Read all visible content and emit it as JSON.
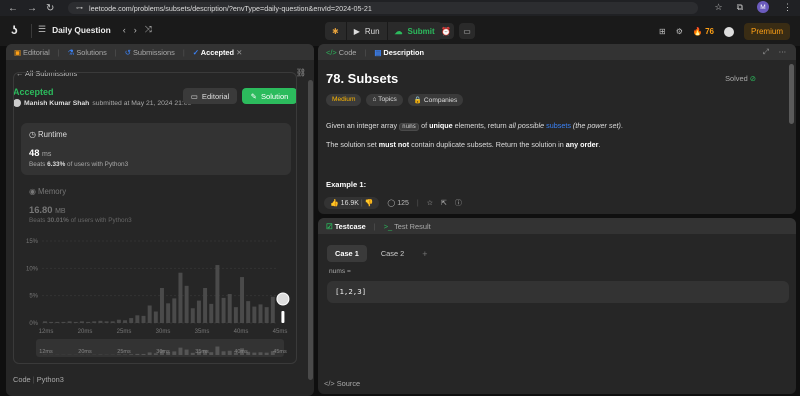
{
  "browser": {
    "url": "leetcode.com/problems/subsets/description/?envType=daily-question&envId=2024-05-21",
    "profile_initial": "M"
  },
  "topbar": {
    "title": "Daily Question",
    "run_label": "Run",
    "submit_label": "Submit",
    "streak_count": "76",
    "premium_label": "Premium"
  },
  "left_panel": {
    "tabs": [
      {
        "label": "Editorial"
      },
      {
        "label": "Solutions"
      },
      {
        "label": "Submissions"
      },
      {
        "label": "Accepted"
      }
    ],
    "all_submissions": "All Submissions",
    "status": "Accepted",
    "author": "Manish Kumar Shah",
    "submitted_text": "submitted at May 21, 2024 21:00",
    "editorial_btn": "Editorial",
    "solution_btn": "Solution",
    "runtime_label": "Runtime",
    "runtime_value": "48",
    "runtime_unit": "ms",
    "runtime_beats_prefix": "Beats",
    "runtime_beats_pct": "6.33%",
    "runtime_beats_suffix": "of users with Python3",
    "memory_label": "Memory",
    "memory_value": "16.80",
    "memory_unit": "MB",
    "memory_beats_prefix": "Beats",
    "memory_beats_pct": "30.01%",
    "memory_beats_suffix": "of users with Python3",
    "code_label": "Code",
    "code_lang": "Python3"
  },
  "chart_data": {
    "type": "bar",
    "y_ticks": [
      "15%",
      "10%",
      "5%",
      "0%"
    ],
    "ylim": [
      0,
      15
    ],
    "x_ticks": [
      "12ms",
      "20ms",
      "25ms",
      "30ms",
      "35ms",
      "40ms",
      "45ms"
    ],
    "values": [
      0.3,
      0.2,
      0.2,
      0.2,
      0.3,
      0.2,
      0.3,
      0.2,
      0.3,
      0.4,
      0.3,
      0.3,
      0.6,
      0.5,
      0.9,
      1.4,
      1.3,
      3.2,
      2.1,
      6.4,
      3.6,
      4.5,
      9.2,
      6.8,
      2.7,
      4.1,
      6.4,
      3.5,
      10.6,
      4.6,
      5.3,
      2.9,
      8.4,
      4.0,
      3.0,
      3.4,
      2.9,
      4.8
    ],
    "highlight_label": "48ms"
  },
  "description_panel": {
    "tabs": [
      {
        "label": "Code"
      },
      {
        "label": "Description"
      }
    ],
    "title": "78. Subsets",
    "solved": "Solved",
    "tags": [
      "Medium",
      "Topics",
      "Companies"
    ],
    "para1": {
      "a": "Given an integer array ",
      "code": "nums",
      "b": " of ",
      "bold": "unique",
      "c": " elements, return ",
      "italic1": "all possible ",
      "link": "subsets",
      "italic2": " (the power set)",
      "d": "."
    },
    "para2": {
      "a": "The solution set ",
      "bold1": "must not",
      "b": " contain duplicate subsets. Return the solution in ",
      "bold2": "any order",
      "c": "."
    },
    "example_heading": "Example 1:",
    "likes": "16.9K",
    "comments": "125"
  },
  "testcase_panel": {
    "tabs": [
      {
        "label": "Testcase"
      },
      {
        "label": "Test Result"
      }
    ],
    "cases": [
      "Case 1",
      "Case 2"
    ],
    "input_label": "nums =",
    "input_value": "[1,2,3]",
    "source_label": "Source"
  },
  "colors": {
    "accent_green": "#2cbb5d",
    "accent_orange": "#ffa116",
    "link_blue": "#3b82f6"
  }
}
